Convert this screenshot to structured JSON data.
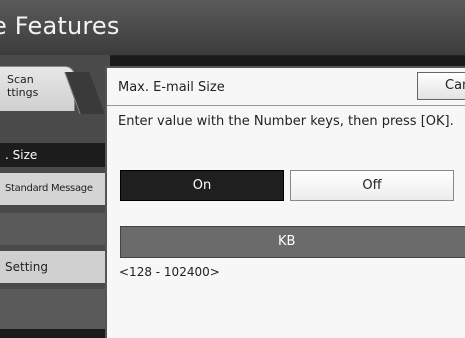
{
  "header": {
    "title": "e Features"
  },
  "left_panel": {
    "tab": {
      "line1": "Scan",
      "line2": "ttings"
    },
    "items": [
      {
        "label": ". Size"
      },
      {
        "label": "Standard Message"
      },
      {
        "label": ""
      },
      {
        "label": "Setting"
      },
      {
        "label": ""
      }
    ]
  },
  "dialog": {
    "title": "Max. E-mail Size",
    "cancel_label": "Can",
    "instruction": "Enter value with the Number keys, then press [OK].",
    "on_label": "On",
    "off_label": "Off",
    "selected": "On",
    "field_unit": "KB",
    "range": "<128 - 102400>"
  },
  "colors": {
    "header": "#4a4a4a",
    "selected_toggle": "#1f1f1f",
    "entry_field": "#6b6b6b"
  }
}
